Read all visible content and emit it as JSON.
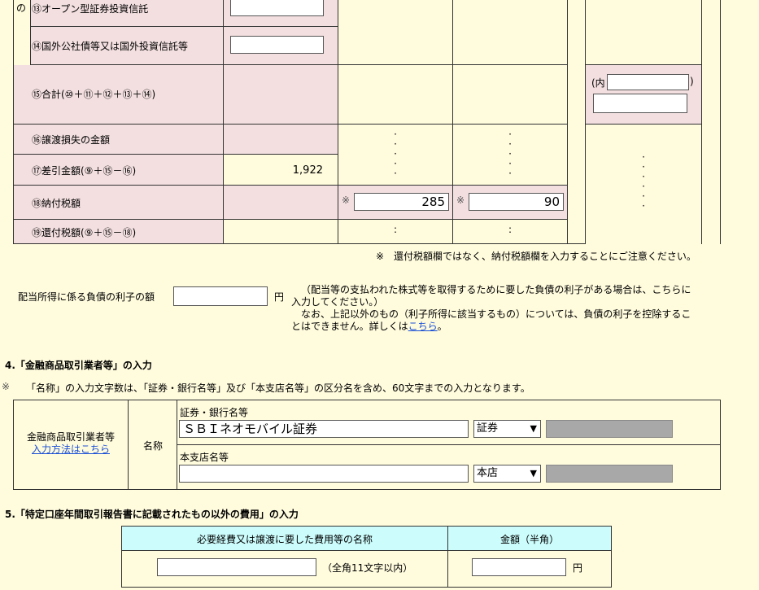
{
  "tax_table": {
    "side_label": "の",
    "rows": [
      {
        "label": "⑬オープン型証券投資信託"
      },
      {
        "label": "⑭国外公社債等又は国外投資信託等"
      },
      {
        "label": "⑮合計(⑩＋⑪＋⑫＋⑬＋⑭)",
        "inner_prefix": "(内",
        "inner_suffix": ")"
      },
      {
        "label": "⑯譲渡損失の金額"
      },
      {
        "label": "⑰差引金額(⑨＋⑮－⑯)",
        "value": "1,922"
      },
      {
        "label": "⑱納付税額",
        "mark1": "※",
        "value1": "285",
        "mark2": "※",
        "value2": "90"
      },
      {
        "label": "⑲還付税額(⑨＋⑮－⑱)"
      }
    ],
    "note": "※　還付税額欄ではなく、納付税額欄を入力することにご注意ください。"
  },
  "interest": {
    "label": "配当所得に係る負債の利子の額",
    "unit": "円",
    "note_line1": "（配当等の支払われた株式等を取得するために要した負債の利子がある場合は、こちらに",
    "note_line2": "入力してください。）",
    "note_line3": "なお、上記以外のもの（利子所得に該当するもの）については、負債の利子を控除するこ",
    "note_line4_prefix": "とはできません。詳しくは",
    "note_link": "こちら",
    "note_line4_suffix": "。"
  },
  "section4": {
    "heading": "4.「金融商品取引業者等」の入力",
    "note_mark": "※",
    "note": "「名称」の入力文字数は、「証券・銀行名等」及び「本支店名等」の区分名を含め、60文字までの入力となります。",
    "left_label": "金融商品取引業者等",
    "left_link": "入力方法はこちら",
    "name_label": "名称",
    "bank_label": "証券・銀行名等",
    "bank_value": "ＳＢＩネオモバイル証券",
    "bank_type": "証券",
    "branch_label": "本支店名等",
    "branch_value": "",
    "branch_type": "本店"
  },
  "section5": {
    "heading": "5.「特定口座年間取引報告書に記載されたもの以外の費用」の入力",
    "col1_header": "必要経費又は譲渡に要した費用等の名称",
    "col2_header": "金額（半角）",
    "name_hint": "（全角11文字以内）",
    "unit": "円"
  }
}
